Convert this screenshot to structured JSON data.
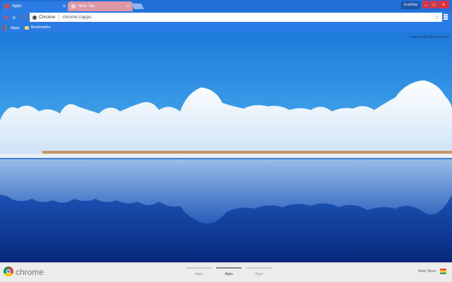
{
  "tabs": [
    {
      "label": "Apps",
      "active": true
    },
    {
      "label": "New Tab",
      "active": false
    }
  ],
  "profile": {
    "label": "EverDay"
  },
  "omnibox": {
    "chip_label": "Chrome",
    "url": "chrome://apps"
  },
  "bookmarks": {
    "apps_label": "Apps",
    "bookmarks_label": "Bookmarks"
  },
  "content": {
    "user_email": "zsubrnopt07@gmail.com"
  },
  "bottom_bar": {
    "brand": "chrome",
    "pages": [
      {
        "label": "Apps",
        "active": false
      },
      {
        "label": "Apps",
        "active": true
      },
      {
        "label": "Apps",
        "active": false
      }
    ],
    "web_store_label": "Web Store"
  },
  "colors": {
    "frame": "#2b7be5",
    "close_button": "#dd3333",
    "sky": "#2f8ee0",
    "water": "#0d3a9a"
  }
}
